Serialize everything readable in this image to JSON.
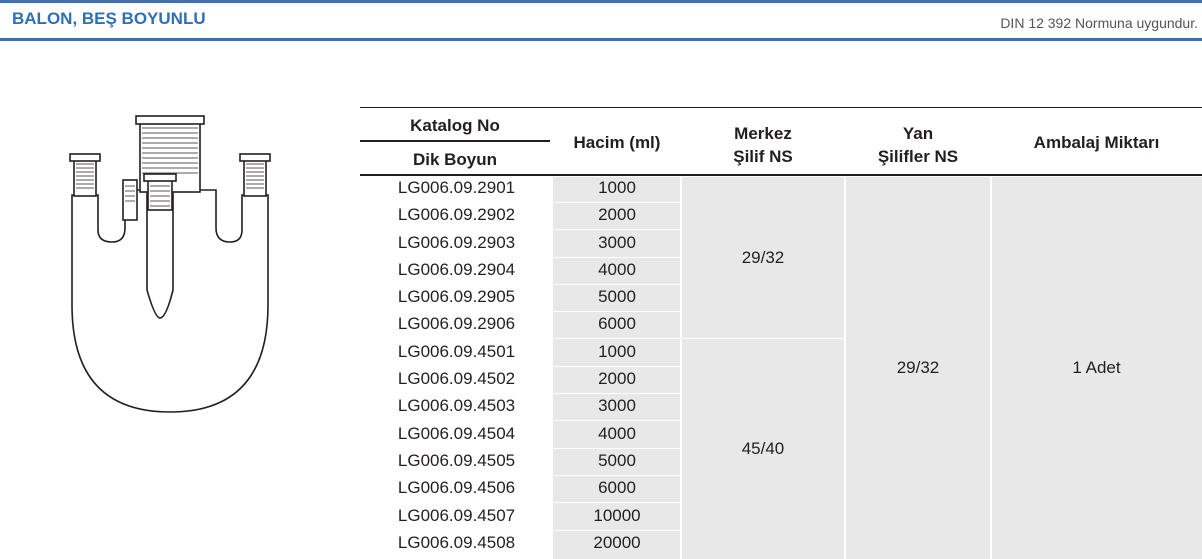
{
  "header": {
    "title": "BALON, BEŞ BOYUNLU",
    "standard_note": "DIN 12 392 Normuna uygundur."
  },
  "table": {
    "columns": {
      "catalog_top": "Katalog No",
      "catalog_bottom": "Dik Boyun",
      "volume": "Hacim (ml)",
      "center_line1": "Merkez",
      "center_line2": "Şilif NS",
      "side_line1": "Yan",
      "side_line2": "Şilifler NS",
      "package": "Ambalaj Miktarı"
    },
    "rows": [
      {
        "catalog": "LG006.09.2901",
        "volume": "1000"
      },
      {
        "catalog": "LG006.09.2902",
        "volume": "2000"
      },
      {
        "catalog": "LG006.09.2903",
        "volume": "3000"
      },
      {
        "catalog": "LG006.09.2904",
        "volume": "4000"
      },
      {
        "catalog": "LG006.09.2905",
        "volume": "5000"
      },
      {
        "catalog": "LG006.09.2906",
        "volume": "6000"
      },
      {
        "catalog": "LG006.09.4501",
        "volume": "1000"
      },
      {
        "catalog": "LG006.09.4502",
        "volume": "2000"
      },
      {
        "catalog": "LG006.09.4503",
        "volume": "3000"
      },
      {
        "catalog": "LG006.09.4504",
        "volume": "4000"
      },
      {
        "catalog": "LG006.09.4505",
        "volume": "5000"
      },
      {
        "catalog": "LG006.09.4506",
        "volume": "6000"
      },
      {
        "catalog": "LG006.09.4507",
        "volume": "10000"
      },
      {
        "catalog": "LG006.09.4508",
        "volume": "20000"
      }
    ],
    "center_groups": [
      "29/32",
      "45/40"
    ],
    "side_value": "29/32",
    "package_value": "1 Adet"
  }
}
